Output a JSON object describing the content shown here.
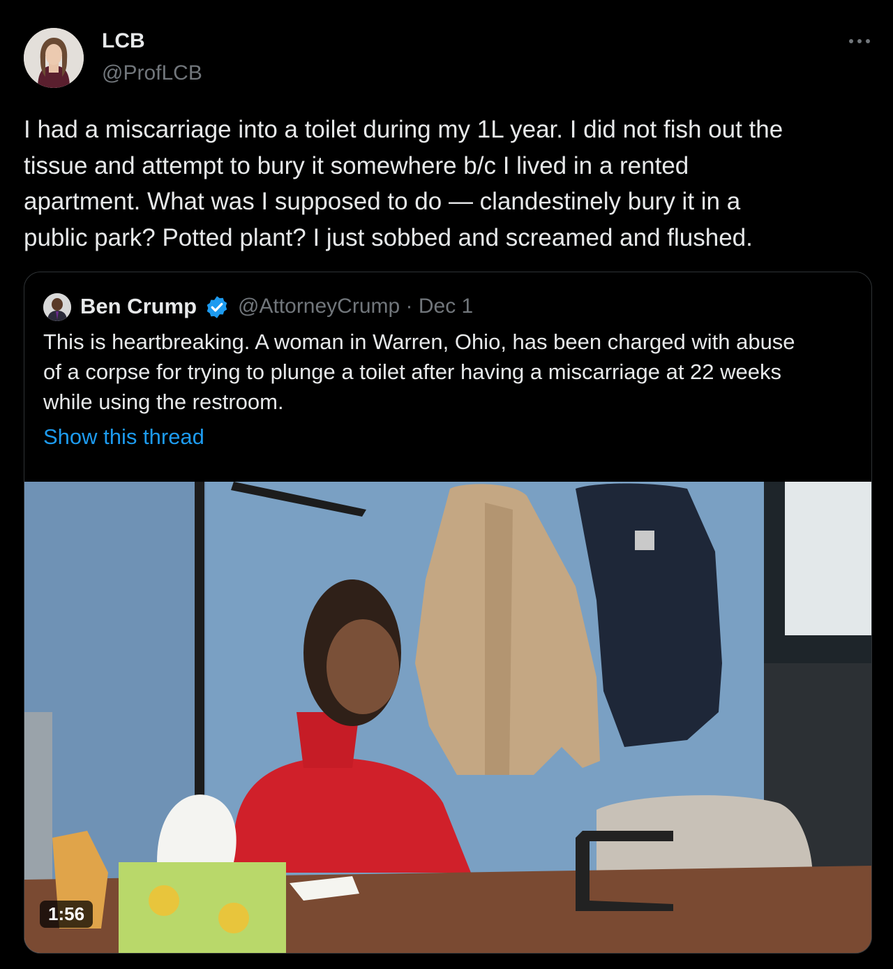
{
  "tweet": {
    "author_name": "LCB",
    "author_handle": "@ProfLCB",
    "text": "I had a miscarriage into a toilet during my 1L year. I did not fish out the\ntissue and attempt to bury it somewhere b/c I lived in a rented\napartment. What was I supposed to do — clandestinely bury it in a\npublic park? Potted plant? I just sobbed and screamed and flushed.",
    "more_icon": "more-horizontal-icon"
  },
  "quote": {
    "author_name": "Ben Crump",
    "verified_icon": "verified-badge-icon",
    "meta": "@AttorneyCrump · Dec 1",
    "text": "This is heartbreaking. A woman in Warren, Ohio, has been charged with abuse\nof a corpse for trying to plunge a toilet after having a miscarriage at 22 weeks\nwhile using the restroom.",
    "show_thread": "Show this thread",
    "video_duration": "1:56"
  },
  "colors": {
    "background": "#000000",
    "primary_text": "#e7e9ea",
    "secondary_text": "#71767b",
    "link": "#1d9bf0",
    "border": "#2f3336"
  }
}
